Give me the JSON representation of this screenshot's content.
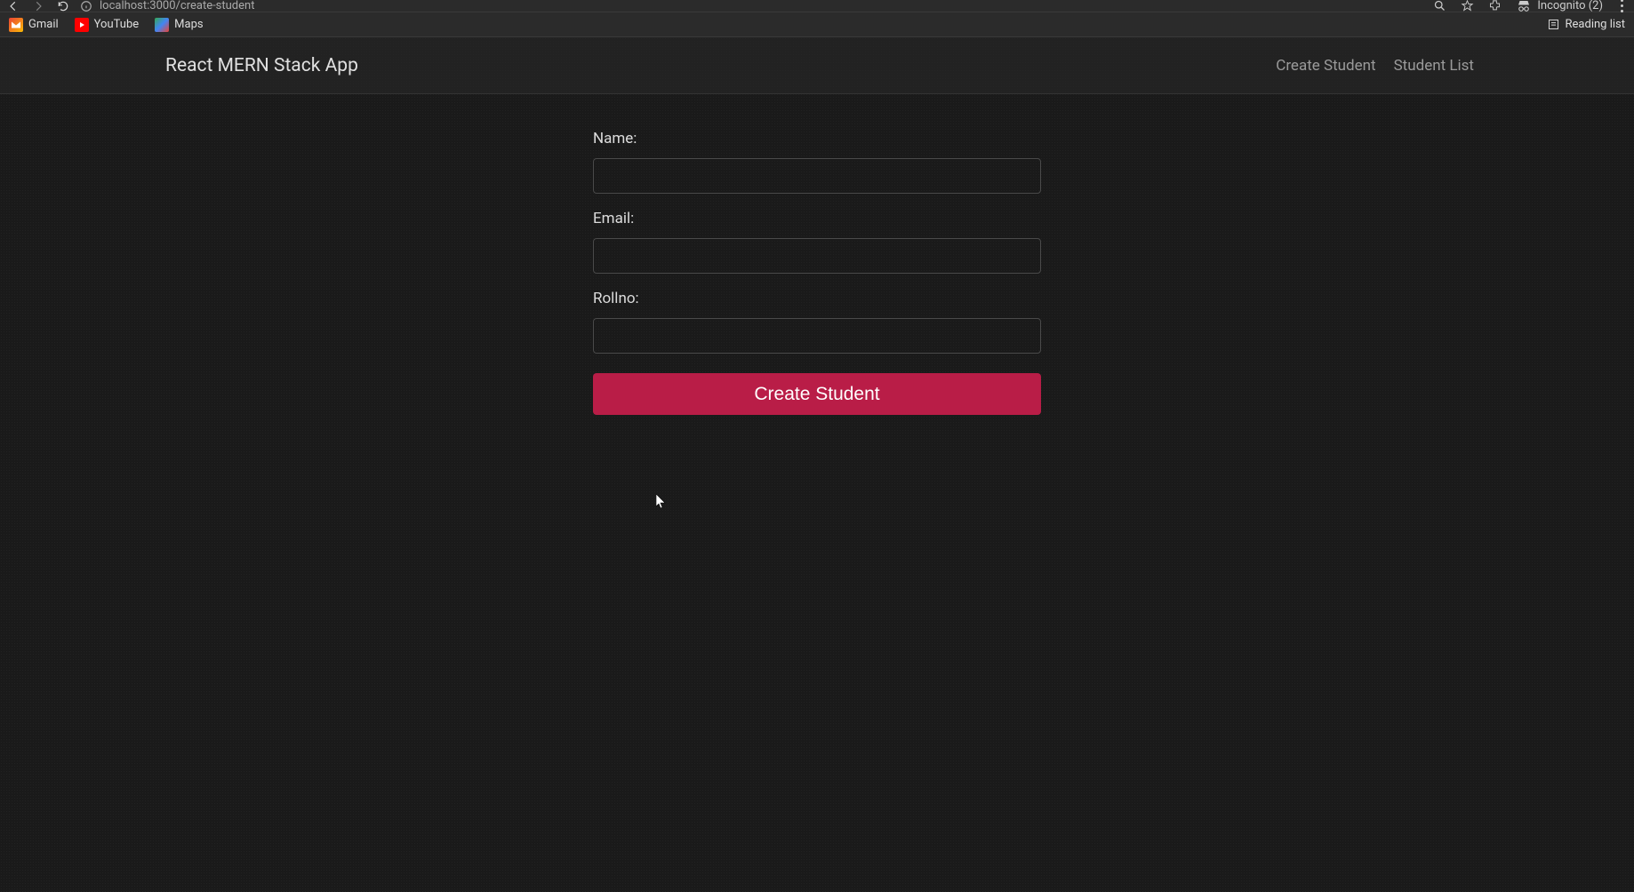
{
  "browser": {
    "url": "localhost:3000/create-student",
    "incognito_label": "Incognito (2)",
    "bookmarks": {
      "gmail": "Gmail",
      "youtube": "YouTube",
      "maps": "Maps",
      "reading_list": "Reading list"
    }
  },
  "navbar": {
    "brand": "React MERN Stack App",
    "links": {
      "create": "Create Student",
      "list": "Student List"
    }
  },
  "form": {
    "name_label": "Name:",
    "name_value": "",
    "email_label": "Email:",
    "email_value": "",
    "rollno_label": "Rollno:",
    "rollno_value": "",
    "submit_label": "Create Student"
  }
}
